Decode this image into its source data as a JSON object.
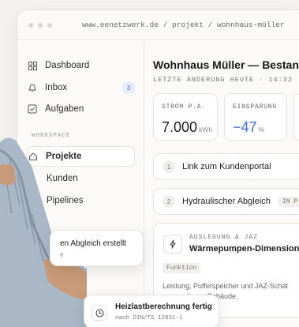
{
  "browser": {
    "url": "www.eenetzwerk.de / projekt / wohnhaus-müller"
  },
  "sidebar": {
    "items": [
      {
        "label": "Dashboard",
        "icon": "grid-icon"
      },
      {
        "label": "Inbox",
        "icon": "bell-icon",
        "badge": "3"
      },
      {
        "label": "Aufgaben",
        "icon": "checkbox-icon"
      }
    ],
    "section_label": "WORKSPACE",
    "workspace_items": [
      {
        "label": "Projekte",
        "icon": "home-icon",
        "active": true
      },
      {
        "label": "Kunden"
      },
      {
        "label": "Pipelines"
      }
    ]
  },
  "main": {
    "title": "Wohnhaus Müller — Bestand",
    "subtitle": "LETZTE ÄNDERUNG HEUTE · 14:32",
    "stats": [
      {
        "label": "STROM P.A.",
        "value": "7.000",
        "unit": "kWh",
        "color": "#1a1a1a"
      },
      {
        "label": "EINSPARUNG",
        "value": "−47",
        "unit": "%",
        "color": "#3b6ed6"
      }
    ],
    "steps": [
      {
        "num": "1",
        "label": "Link zum Kundenportal"
      },
      {
        "num": "2",
        "label": "Hydraulischer Abgleich",
        "tag": "IN P"
      }
    ],
    "feature": {
      "kicker": "AUSLEGUNG & JAZ",
      "title": "Wärmepumpen-Dimensionie",
      "tag": "Funktion",
      "desc_line1": "Leistung, Pufferspeicher und JAZ-Schät",
      "desc_line2": "passend zum Gebäude."
    }
  },
  "toasts": [
    {
      "title": "en Abgleich erstellt",
      "sub": "e"
    },
    {
      "title": "Heizlastberechnung fertig",
      "sub": "nach DIN/TS 12831-1",
      "icon": "clock-icon"
    }
  ]
}
